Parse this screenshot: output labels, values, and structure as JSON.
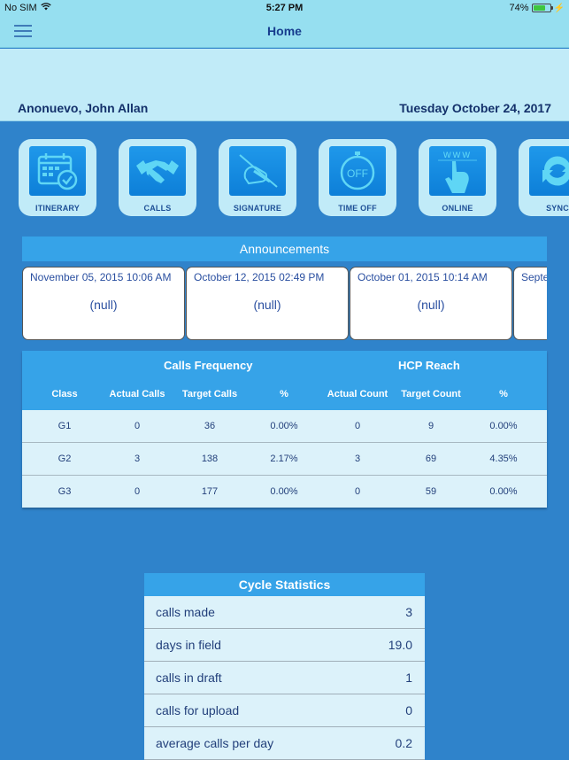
{
  "status_bar": {
    "carrier": "No SIM",
    "time": "5:27 PM",
    "battery": "74%",
    "battery_level": 0.74
  },
  "nav": {
    "title": "Home"
  },
  "user": {
    "name": "Anonuevo, John Allan",
    "date": "Tuesday October 24, 2017"
  },
  "tiles": [
    {
      "label": "ITINERARY",
      "icon": "calendar-check-icon"
    },
    {
      "label": "CALLS",
      "icon": "handshake-icon"
    },
    {
      "label": "SIGNATURE",
      "icon": "signature-icon"
    },
    {
      "label": "TIME OFF",
      "icon": "stopwatch-off-icon",
      "icon_text": "OFF"
    },
    {
      "label": "ONLINE",
      "icon": "www-hand-icon",
      "icon_text": "www"
    },
    {
      "label": "SYNC",
      "icon": "sync-icon"
    }
  ],
  "announcements": {
    "title": "Announcements",
    "items": [
      {
        "date": "November 05, 2015 10:06 AM",
        "body": "(null)"
      },
      {
        "date": "October 12, 2015 02:49 PM",
        "body": "(null)"
      },
      {
        "date": "October 01, 2015 10:14 AM",
        "body": "(null)"
      },
      {
        "date": "Septe",
        "body": ""
      }
    ]
  },
  "calls_table": {
    "groups": [
      "Calls Frequency",
      "HCP Reach"
    ],
    "columns": [
      "Class",
      "Actual Calls",
      "Target Calls",
      "%",
      "Actual Count",
      "Target Count",
      "%"
    ],
    "rows": [
      [
        "G1",
        "0",
        "36",
        "0.00%",
        "0",
        "9",
        "0.00%"
      ],
      [
        "G2",
        "3",
        "138",
        "2.17%",
        "3",
        "69",
        "4.35%"
      ],
      [
        "G3",
        "0",
        "177",
        "0.00%",
        "0",
        "59",
        "0.00%"
      ]
    ]
  },
  "cycle_stats": {
    "title": "Cycle Statistics",
    "rows": [
      {
        "label": "calls made",
        "value": "3"
      },
      {
        "label": "days in field",
        "value": "19.0"
      },
      {
        "label": "calls in draft",
        "value": "1"
      },
      {
        "label": "calls for upload",
        "value": "0"
      },
      {
        "label": "average calls per day",
        "value": "0.2"
      }
    ]
  },
  "colors": {
    "nav_bg": "#96dff0",
    "user_bg": "#c1ebf8",
    "page_bg": "#2f83cb",
    "header_blue": "#36a3e8",
    "row_bg": "#dcf2fa",
    "text_dark_blue": "#14316b"
  }
}
